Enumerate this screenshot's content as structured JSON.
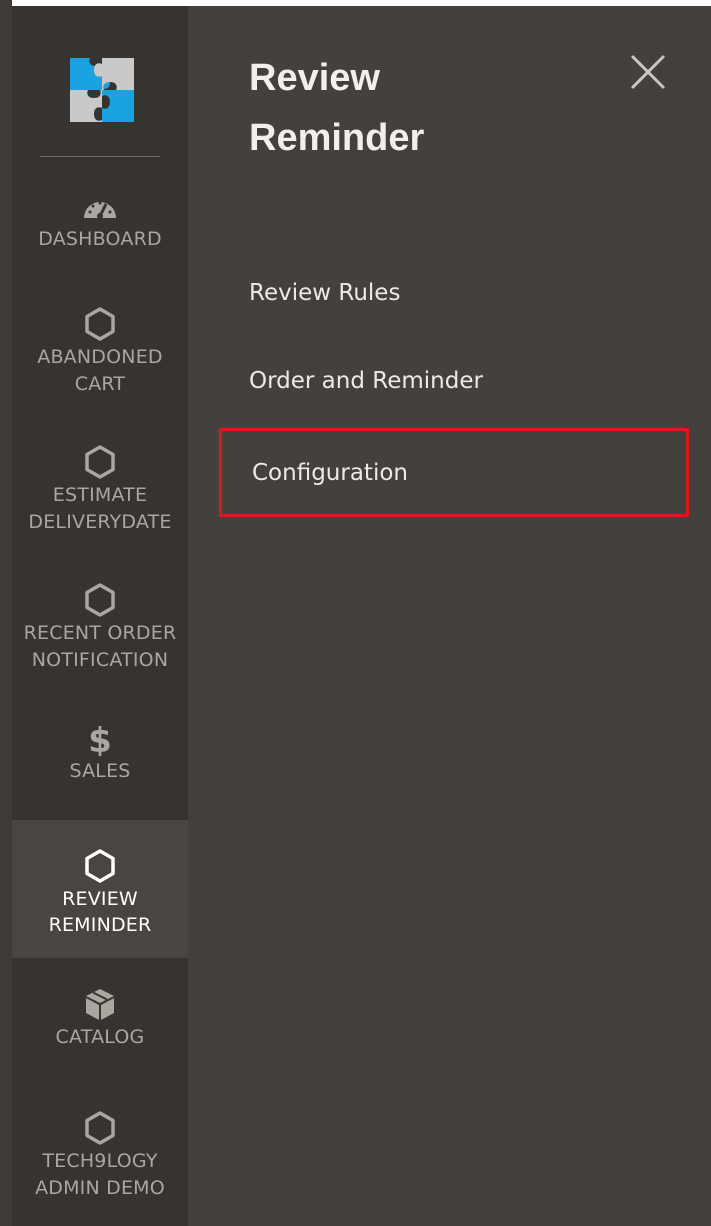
{
  "colors": {
    "sidebar_bg": "#373330",
    "panel_bg": "#44403e",
    "active_item_bg": "#4a4542",
    "highlight_border": "#e0161a",
    "logo_blue": "#1aa3e0",
    "logo_gray": "#c9c9c9"
  },
  "sidebar": {
    "logo_icon": "puzzle-logo",
    "items": [
      {
        "label": "DASHBOARD",
        "icon": "dashboard-gauge-icon"
      },
      {
        "label": "ABANDONED\nCART",
        "icon": "hexagon-icon"
      },
      {
        "label": "ESTIMATE\nDELIVERYDATE",
        "icon": "hexagon-icon"
      },
      {
        "label": "RECENT ORDER\nNOTIFICATION",
        "icon": "hexagon-icon"
      },
      {
        "label": "SALES",
        "icon": "dollar-icon"
      },
      {
        "label": "REVIEW\nREMINDER",
        "icon": "hexagon-icon",
        "active": true
      },
      {
        "label": "CATALOG",
        "icon": "box-icon"
      },
      {
        "label": "TECH9LOGY\nADMIN DEMO",
        "icon": "hexagon-icon"
      }
    ]
  },
  "panel": {
    "title": "Review\nReminder",
    "close_icon": "close-icon",
    "links": [
      {
        "label": "Review Rules"
      },
      {
        "label": "Order and Reminder"
      },
      {
        "label": "Configuration",
        "highlighted": true
      }
    ]
  }
}
